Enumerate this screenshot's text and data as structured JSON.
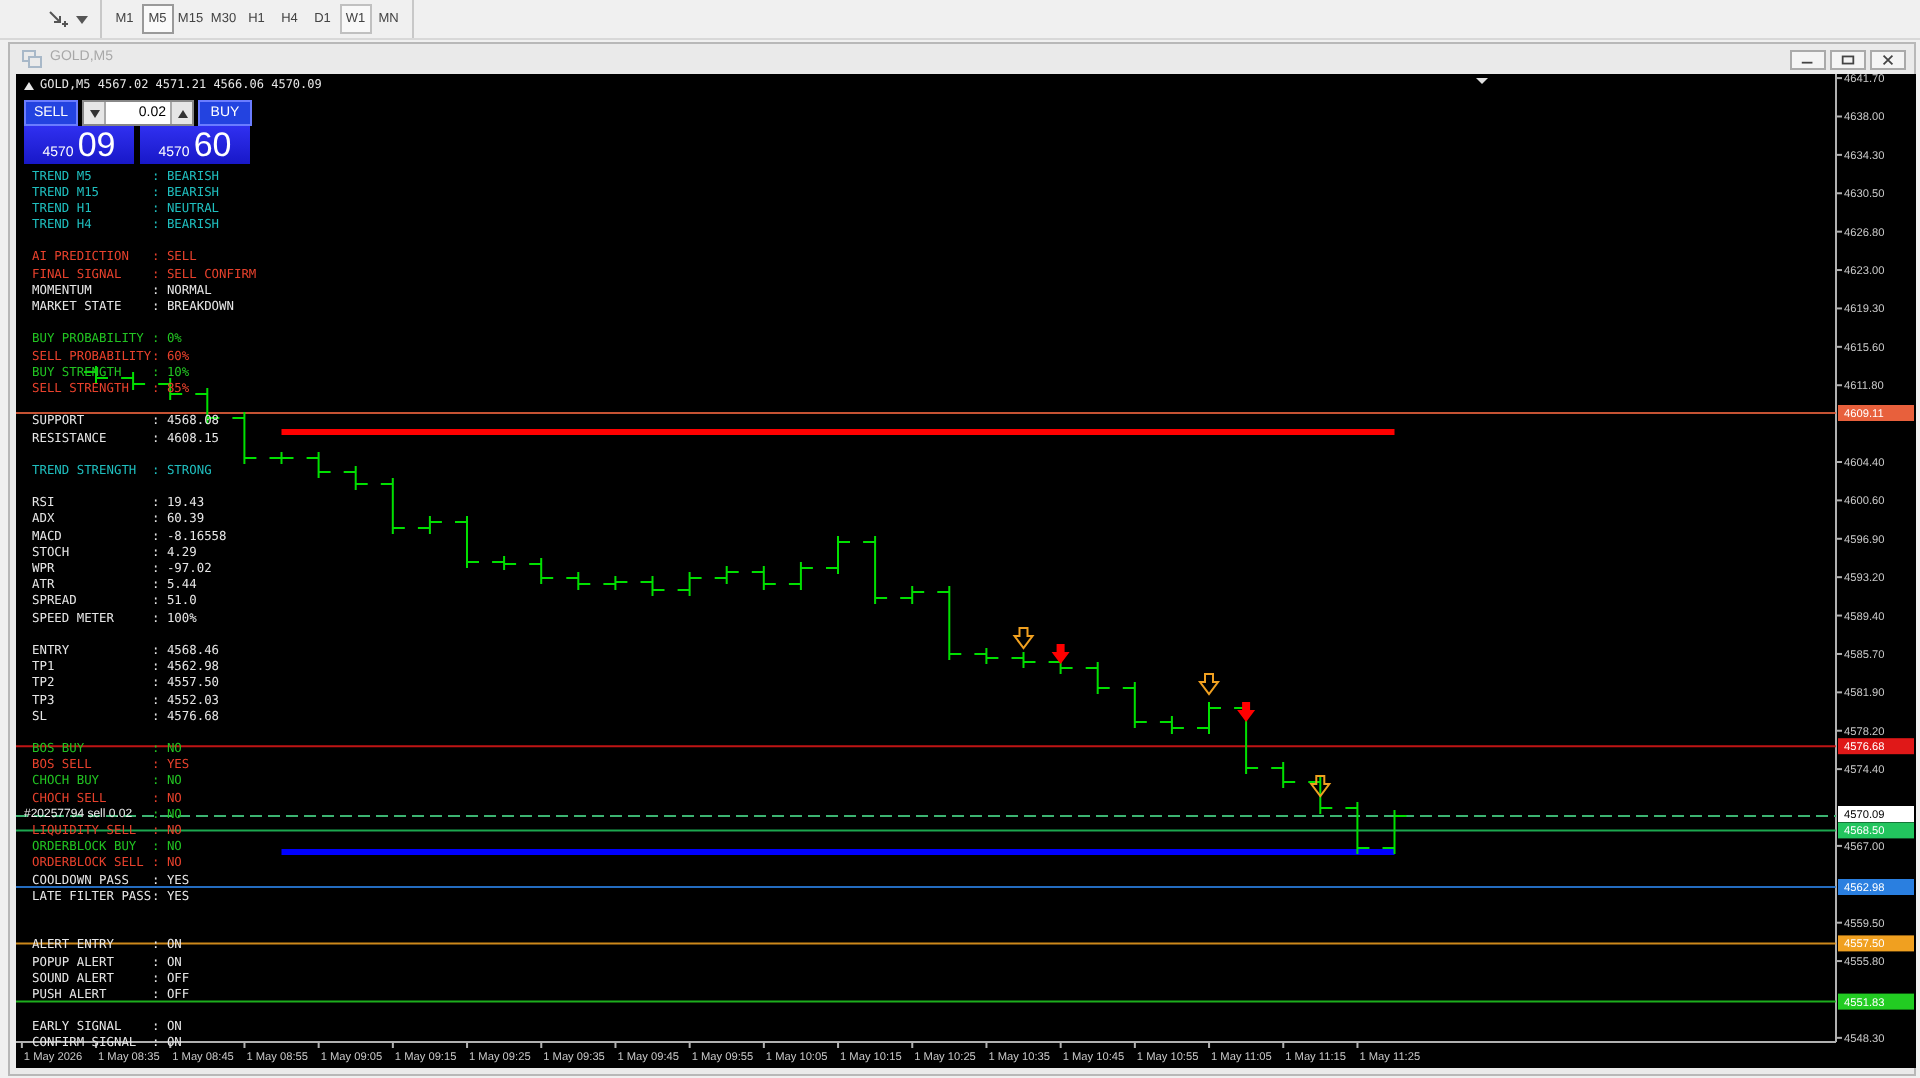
{
  "toolbar": {
    "timeframes": [
      {
        "label": "M1",
        "selected": false,
        "hovered": false
      },
      {
        "label": "M5",
        "selected": true,
        "hovered": false
      },
      {
        "label": "M15",
        "selected": false,
        "hovered": false
      },
      {
        "label": "M30",
        "selected": false,
        "hovered": false
      },
      {
        "label": "H1",
        "selected": false,
        "hovered": false
      },
      {
        "label": "H4",
        "selected": false,
        "hovered": false
      },
      {
        "label": "D1",
        "selected": false,
        "hovered": false
      },
      {
        "label": "W1",
        "selected": false,
        "hovered": true
      },
      {
        "label": "MN",
        "selected": false,
        "hovered": false
      }
    ]
  },
  "window": {
    "title": "GOLD,M5"
  },
  "chart": {
    "header": "GOLD,M5  4567.02 4571.21 4566.06 4570.09",
    "trade_panel": {
      "sell_label": "SELL",
      "buy_label": "BUY",
      "lot": "0.02",
      "sell_price": {
        "figure": "4570",
        "points": "09"
      },
      "buy_price": {
        "figure": "4570",
        "points": "60"
      }
    },
    "indicator_groups": [
      {
        "rows": [
          {
            "label": "TREND M5",
            "value": ": BEARISH",
            "color": "#1fbfbf"
          },
          {
            "label": "TREND M15",
            "value": ": BEARISH",
            "color": "#1fbfbf"
          },
          {
            "label": "TREND H1",
            "value": ": NEUTRAL",
            "color": "#1fbfbf"
          },
          {
            "label": "TREND H4",
            "value": ": BEARISH",
            "color": "#1fbfbf"
          }
        ]
      },
      {
        "rows": [
          {
            "label": "AI PREDICTION",
            "value": ": SELL",
            "color": "#e8412c"
          },
          {
            "label": "FINAL SIGNAL",
            "value": ": SELL CONFIRM",
            "color": "#e8412c"
          },
          {
            "label": "MOMENTUM",
            "value": ": NORMAL",
            "color": "#e6e6e6"
          },
          {
            "label": "MARKET STATE",
            "value": ": BREAKDOWN",
            "color": "#e6e6e6"
          }
        ]
      },
      {
        "rows": [
          {
            "label": "BUY PROBABILITY",
            "value": ": 0%",
            "color": "#22c322"
          },
          {
            "label": "SELL PROBABILITY",
            "value": ": 60%",
            "color": "#e8412c"
          },
          {
            "label": "BUY STRENGTH",
            "value": ": 10%",
            "color": "#22c322"
          },
          {
            "label": "SELL STRENGTH",
            "value": ": 85%",
            "color": "#e8412c"
          }
        ]
      },
      {
        "rows": [
          {
            "label": "SUPPORT",
            "value": ": 4568.08",
            "color": "#e6e6e6"
          },
          {
            "label": "RESISTANCE",
            "value": ": 4608.15",
            "color": "#e6e6e6"
          }
        ]
      },
      {
        "rows": [
          {
            "label": "TREND STRENGTH",
            "value": ": STRONG",
            "color": "#1fbfbf"
          }
        ]
      },
      {
        "rows": [
          {
            "label": "RSI",
            "value": ": 19.43",
            "color": "#e6e6e6"
          },
          {
            "label": "ADX",
            "value": ": 60.39",
            "color": "#e6e6e6"
          },
          {
            "label": "MACD",
            "value": ": -8.16558",
            "color": "#e6e6e6"
          },
          {
            "label": "STOCH",
            "value": ": 4.29",
            "color": "#e6e6e6"
          },
          {
            "label": "WPR",
            "value": ": -97.02",
            "color": "#e6e6e6"
          },
          {
            "label": "ATR",
            "value": ": 5.44",
            "color": "#e6e6e6"
          },
          {
            "label": "SPREAD",
            "value": ": 51.0",
            "color": "#e6e6e6"
          },
          {
            "label": "SPEED METER",
            "value": ": 100%",
            "color": "#e6e6e6"
          }
        ]
      },
      {
        "rows": [
          {
            "label": "ENTRY",
            "value": ": 4568.46",
            "color": "#e6e6e6"
          },
          {
            "label": "TP1",
            "value": ": 4562.98",
            "color": "#e6e6e6"
          },
          {
            "label": "TP2",
            "value": ": 4557.50",
            "color": "#e6e6e6"
          },
          {
            "label": "TP3",
            "value": ": 4552.03",
            "color": "#e6e6e6"
          },
          {
            "label": "SL",
            "value": ": 4576.68",
            "color": "#e6e6e6"
          }
        ]
      },
      {
        "rows": [
          {
            "label": "BOS BUY",
            "value": ": NO",
            "color": "#22c322"
          },
          {
            "label": "BOS SELL",
            "value": ": YES",
            "color": "#e8412c"
          },
          {
            "label": "CHOCH BUY",
            "value": ": NO",
            "color": "#22c322"
          },
          {
            "label": "CHOCH SELL",
            "value": ": NO",
            "color": "#e8412c"
          },
          {
            "value": ": NO",
            "color": "#22c322"
          },
          {
            "label": "LIQUIDITY SELL",
            "value": ": NO",
            "color": "#e8412c"
          },
          {
            "label": "ORDERBLOCK BUY",
            "value": ": NO",
            "color": "#22c322"
          },
          {
            "label": "ORDERBLOCK SELL",
            "value": ": NO",
            "color": "#e8412c"
          },
          {
            "label": "COOLDOWN PASS",
            "value": ": YES",
            "color": "#e6e6e6"
          },
          {
            "label": "LATE FILTER PASS",
            "value": ": YES",
            "color": "#e6e6e6"
          }
        ]
      },
      {
        "rows": [
          {
            "label": "ALERT ENTRY",
            "value": ": ON",
            "color": "#e6e6e6"
          },
          {
            "label": "POPUP ALERT",
            "value": ": ON",
            "color": "#e6e6e6"
          },
          {
            "label": "SOUND ALERT",
            "value": ": OFF",
            "color": "#e6e6e6"
          },
          {
            "label": "PUSH ALERT",
            "value": ": OFF",
            "color": "#e6e6e6"
          }
        ]
      },
      {
        "rows": [
          {
            "label": "EARLY SIGNAL",
            "value": ": ON",
            "color": "#e6e6e6"
          },
          {
            "label": "CONFIRM SIGNAL",
            "value": ": ON",
            "color": "#e6e6e6"
          }
        ]
      }
    ],
    "order_label": "#20257794 sell 0.02",
    "price_axis": [
      "4641.70",
      "4638.00",
      "4634.30",
      "4630.50",
      "4626.80",
      "4623.00",
      "4619.30",
      "4615.60",
      "4611.80",
      "4604.40",
      "4600.60",
      "4596.90",
      "4593.20",
      "4589.40",
      "4585.70",
      "4581.90",
      "4578.20",
      "4574.40",
      "4567.00",
      "4559.50",
      "4555.80",
      "4548.30"
    ],
    "time_axis": [
      "1 May 2026",
      "1 May 08:35",
      "1 May 08:45",
      "1 May 08:55",
      "1 May 09:05",
      "1 May 09:15",
      "1 May 09:25",
      "1 May 09:35",
      "1 May 09:45",
      "1 May 09:55",
      "1 May 10:05",
      "1 May 10:15",
      "1 May 10:25",
      "1 May 10:35",
      "1 May 10:45",
      "1 May 10:55",
      "1 May 11:05",
      "1 May 11:15",
      "1 May 11:25"
    ],
    "price_tags": [
      {
        "label": "4609.11",
        "color": "#e8603c"
      },
      {
        "label": "4576.68",
        "color": "#e01818"
      },
      {
        "label": "4570.09",
        "color": "#ffffff"
      },
      {
        "label": "4568.50",
        "color": "#22c55e"
      },
      {
        "label": "4562.98",
        "color": "#2a7fe0"
      },
      {
        "label": "4557.50",
        "color": "#f0a020"
      },
      {
        "label": "4551.83",
        "color": "#22cc22"
      }
    ]
  }
}
